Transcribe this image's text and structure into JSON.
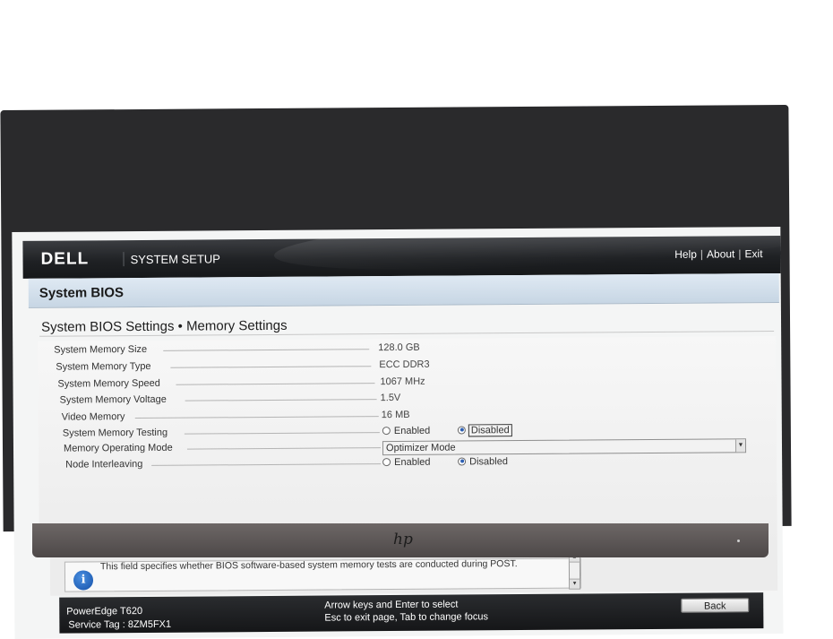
{
  "header": {
    "brand": "DELL",
    "title": "SYSTEM SETUP",
    "links": [
      "Help",
      "About",
      "Exit"
    ]
  },
  "section": {
    "title": "System BIOS"
  },
  "breadcrumb": "System BIOS Settings • Memory Settings",
  "settings": {
    "system_memory_size": {
      "label": "System Memory Size",
      "value": "128.0 GB"
    },
    "system_memory_type": {
      "label": "System Memory Type",
      "value": "ECC DDR3"
    },
    "system_memory_speed": {
      "label": "System Memory Speed",
      "value": "1067 MHz"
    },
    "system_memory_voltage": {
      "label": "System Memory Voltage",
      "value": "1.5V"
    },
    "video_memory": {
      "label": "Video Memory",
      "value": "16 MB"
    },
    "system_memory_testing": {
      "label": "System Memory Testing",
      "options": [
        "Enabled",
        "Disabled"
      ],
      "selected": "Disabled"
    },
    "memory_operating_mode": {
      "label": "Memory Operating Mode",
      "value": "Optimizer Mode"
    },
    "node_interleaving": {
      "label": "Node Interleaving",
      "options": [
        "Enabled",
        "Disabled"
      ],
      "selected": "Disabled"
    }
  },
  "help": {
    "text": "This field specifies whether BIOS software-based system memory tests are conducted during POST."
  },
  "footer": {
    "model": "PowerEdge T620",
    "service_tag": "Service Tag : 8ZM5FX1",
    "hint_line1": "Arrow keys and Enter to select",
    "hint_line2": "Esc to exit page, Tab to change focus",
    "back_label": "Back"
  },
  "monitor": {
    "logo": "hp"
  },
  "colors": {
    "header_bg": "#1f2124",
    "section_band": "#c7d6e4",
    "screen_bg": "#f4f5f5",
    "radio_selected": "#2d5fb3"
  }
}
